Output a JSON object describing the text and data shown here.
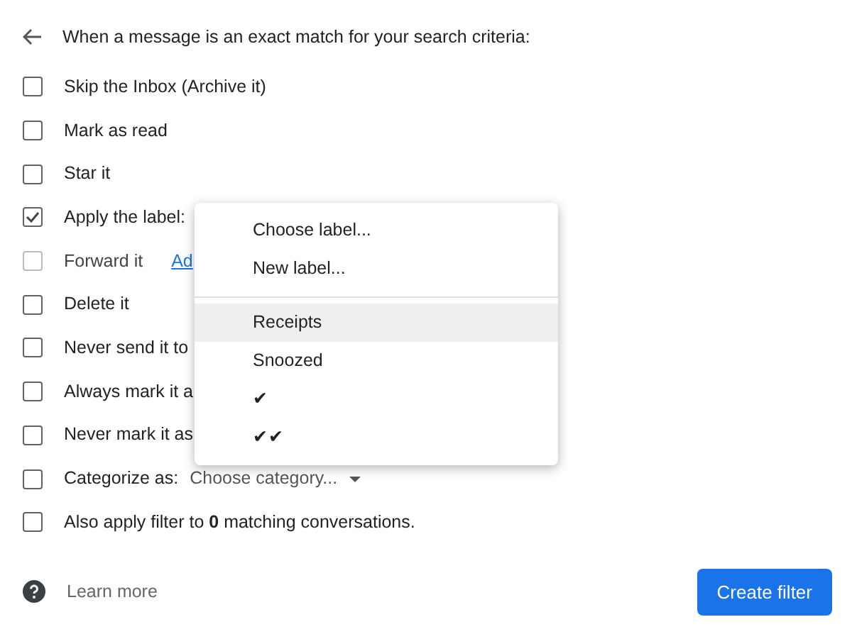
{
  "header": {
    "title": "When a message is an exact match for your search criteria:"
  },
  "actions": [
    {
      "label": "Skip the Inbox (Archive it)",
      "checked": false,
      "disabled": false
    },
    {
      "label": "Mark as read",
      "checked": false,
      "disabled": false
    },
    {
      "label": "Star it",
      "checked": false,
      "disabled": false
    },
    {
      "label": "Apply the label:",
      "checked": true,
      "disabled": false
    },
    {
      "label": "Forward it",
      "checked": false,
      "disabled": true,
      "link": "Ad"
    },
    {
      "label": "Delete it",
      "checked": false,
      "disabled": false
    },
    {
      "label": "Never send it to",
      "checked": false,
      "disabled": false
    },
    {
      "label": "Always mark it a",
      "checked": false,
      "disabled": false
    },
    {
      "label": "Never mark it as",
      "checked": false,
      "disabled": false
    },
    {
      "label": "Categorize as:",
      "checked": false,
      "disabled": false,
      "select": "Choose category..."
    },
    {
      "label": "Also apply filter to **0** matching conversations.",
      "checked": false,
      "disabled": false
    }
  ],
  "label_menu": {
    "sections": [
      [
        {
          "label": "Choose label...",
          "selected": false
        },
        {
          "label": "New label...",
          "selected": false
        }
      ],
      [
        {
          "label": "Receipts",
          "selected": true
        },
        {
          "label": "Snoozed",
          "selected": false
        },
        {
          "label": "✔",
          "selected": false
        },
        {
          "label": "✔✔",
          "selected": false
        }
      ]
    ]
  },
  "footer": {
    "help_link": "Learn more",
    "button": "Create filter"
  }
}
